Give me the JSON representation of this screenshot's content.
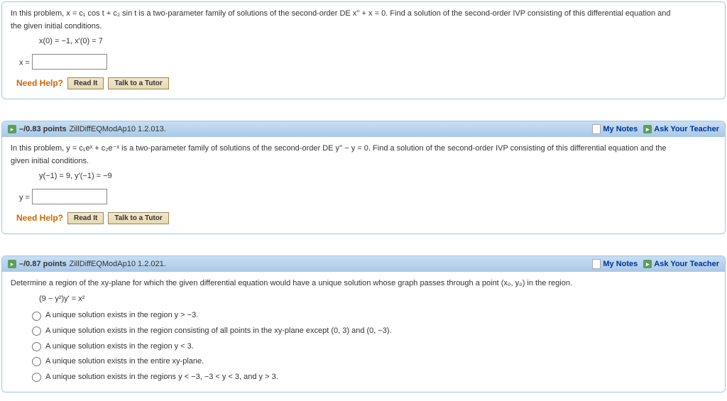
{
  "q1": {
    "problem_a": "In this problem,  x = c₁ cos t + c₂ sin t  is a two-parameter family of solutions of the second-order DE  x'' + x = 0.  Find a solution of the second-order IVP consisting of this differential equation and",
    "problem_b": "the given initial conditions.",
    "conds": "x(0) = −1,    x'(0) = 7",
    "var": "x ="
  },
  "q2": {
    "points": "–/0.83 points",
    "source": "ZillDiffEQModAp10 1.2.013.",
    "my_notes": "My Notes",
    "ask": "Ask Your Teacher",
    "problem_a": "In this problem,  y = c₁eˣ + c₂e⁻ˣ  is a two-parameter family of solutions of the second-order DE  y'' − y = 0.  Find a solution of the second-order IVP consisting of this differential equation and the",
    "problem_b": "given initial conditions.",
    "conds": "y(−1) = 9,    y'(−1) = −9",
    "var": "y ="
  },
  "q3": {
    "points": "–/0.87 points",
    "source": "ZillDiffEQModAp10 1.2.021.",
    "my_notes": "My Notes",
    "ask": "Ask Your Teacher",
    "problem": "Determine a region of the xy-plane for which the given differential equation would have a unique solution whose graph passes through a point  (x₀, y₀)  in the region.",
    "eq": "(9 − y²)y' = x²",
    "opts": [
      "A unique solution exists in the region y > −3.",
      "A unique solution exists in the region consisting of all points in the xy-plane except (0, 3) and (0, −3).",
      "A unique solution exists in the region y < 3.",
      "A unique solution exists in the entire xy-plane.",
      "A unique solution exists in the regions y < −3, −3 < y < 3, and y > 3."
    ]
  },
  "help": {
    "label": "Need Help?",
    "read": "Read It",
    "tutor": "Talk to a Tutor"
  }
}
